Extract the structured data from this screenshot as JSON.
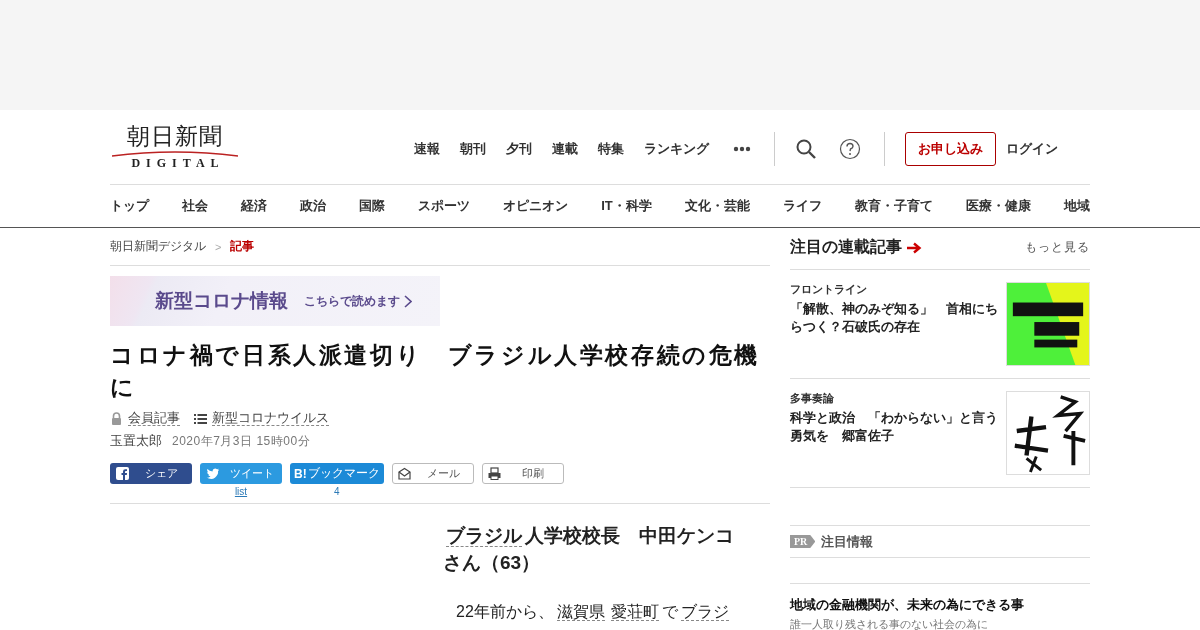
{
  "header": {
    "logo": {
      "title": "朝日新聞",
      "subtitle": "DIGITAL"
    },
    "nav": [
      "速報",
      "朝刊",
      "夕刊",
      "連載",
      "特集",
      "ランキング"
    ],
    "subscribe": "お申し込み",
    "login": "ログイン"
  },
  "categories": [
    "トップ",
    "社会",
    "経済",
    "政治",
    "国際",
    "スポーツ",
    "オピニオン",
    "IT・科学",
    "文化・芸能",
    "ライフ",
    "教育・子育て",
    "医療・健康",
    "地域"
  ],
  "breadcrumb": {
    "separator": ">",
    "items": [
      {
        "label": "朝日新聞デジタル",
        "current": false
      },
      {
        "label": "記事",
        "current": true
      }
    ]
  },
  "promo_banner": {
    "title": "新型コロナ情報",
    "link": "こちらで読めます"
  },
  "article": {
    "title": "コロナ禍で日系人派遣切り　ブラジル人学校存続の危機に",
    "tags": [
      {
        "kind": "lock",
        "label": "会員記事"
      },
      {
        "kind": "list",
        "label": "新型コロナウイルス"
      }
    ],
    "author": "玉置太郎",
    "date": "2020年7月3日 15時00分",
    "share_buttons": [
      {
        "kind": "facebook",
        "label": "シェア"
      },
      {
        "kind": "twitter",
        "label": "ツイート",
        "count": "list"
      },
      {
        "kind": "hatena",
        "icon_text": "B!",
        "label": "ブックマーク",
        "count": "4"
      },
      {
        "kind": "mail",
        "label": "メール"
      },
      {
        "kind": "print",
        "label": "印刷"
      }
    ],
    "subheading": [
      {
        "text": "ブラジル",
        "link": true
      },
      {
        "text": "人学校校長　中田ケンコさん（63）",
        "link": false
      }
    ],
    "body": [
      {
        "text": "22年前から、",
        "link": false
      },
      {
        "text": "滋賀県",
        "link": true
      },
      {
        "text": "愛荘町",
        "link": true
      },
      {
        "text": "で",
        "link": false
      },
      {
        "text": "ブラジ",
        "link": true
      }
    ]
  },
  "sidebar": {
    "title": "注目の連載記事",
    "more": "もっと見る",
    "items": [
      {
        "series": "フロントライン",
        "headline": "「解散、神のみぞ知る」　首相にちらつく？石破氏の存在"
      },
      {
        "series": "多事奏論",
        "headline": "科学と政治　「わからない」と言う勇気を　郷富佐子"
      }
    ],
    "pr": {
      "badge": "PR",
      "title": "注目情報",
      "headline": "地域の金融機関が、未来の為にできる事",
      "description": "誰一人取り残される事のない社会の為に"
    }
  }
}
